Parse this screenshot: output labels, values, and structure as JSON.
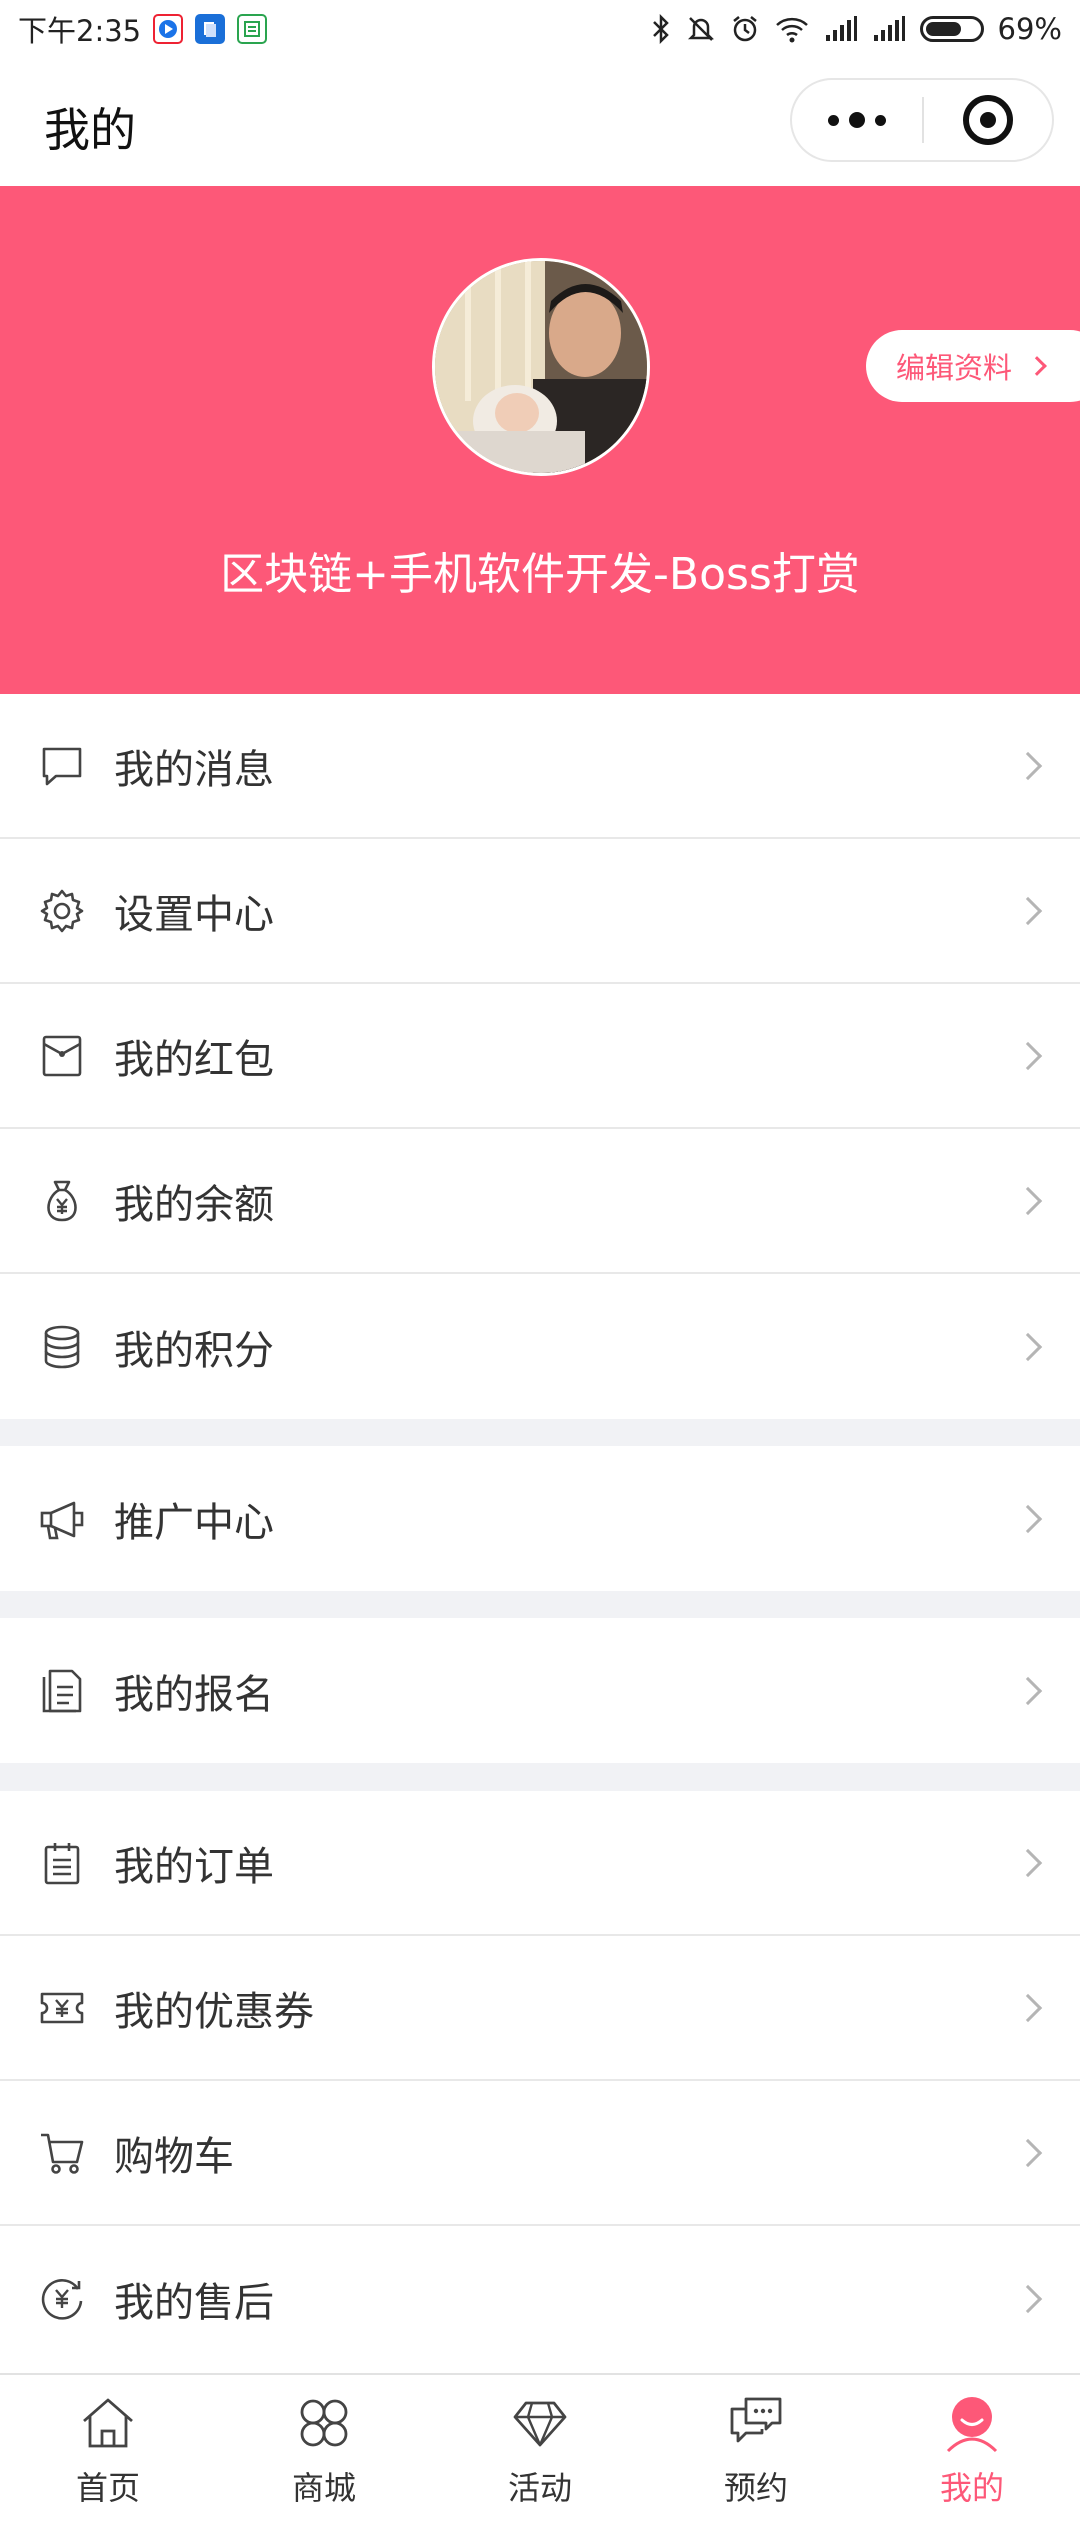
{
  "status_bar": {
    "time": "下午2:35",
    "battery": "69%",
    "battery_level": 0.69,
    "app_icons": [
      "video-app-icon",
      "docs-app-icon",
      "news-app-icon"
    ],
    "indicators": [
      "bluetooth-icon",
      "mute-icon",
      "alarm-icon",
      "wifi-icon",
      "signal-icon",
      "signal-icon"
    ]
  },
  "title_bar": {
    "title": "我的"
  },
  "profile": {
    "edit_label": "编辑资料",
    "nickname": "区块链+手机软件开发-Boss打赏",
    "accent_color": "#fd5878"
  },
  "menu_groups": [
    [
      {
        "label": "我的消息",
        "icon": "message-icon"
      },
      {
        "label": "设置中心",
        "icon": "gear-icon"
      },
      {
        "label": "我的红包",
        "icon": "red-packet-icon"
      },
      {
        "label": "我的余额",
        "icon": "money-bag-icon"
      },
      {
        "label": "我的积分",
        "icon": "coins-stack-icon"
      }
    ],
    [
      {
        "label": "推广中心",
        "icon": "megaphone-icon"
      }
    ],
    [
      {
        "label": "我的报名",
        "icon": "document-icon"
      }
    ],
    [
      {
        "label": "我的订单",
        "icon": "clipboard-icon"
      },
      {
        "label": "我的优惠券",
        "icon": "coupon-icon"
      },
      {
        "label": "购物车",
        "icon": "cart-icon"
      },
      {
        "label": "我的售后",
        "icon": "after-sale-icon"
      }
    ]
  ],
  "tab_bar": {
    "tabs": [
      {
        "label": "首页",
        "icon": "home-icon"
      },
      {
        "label": "商城",
        "icon": "grid-icon"
      },
      {
        "label": "活动",
        "icon": "diamond-icon"
      },
      {
        "label": "预约",
        "icon": "chat-icon"
      },
      {
        "label": "我的",
        "icon": "user-icon"
      }
    ],
    "active_index": 4,
    "active_color": "#fd5878"
  }
}
